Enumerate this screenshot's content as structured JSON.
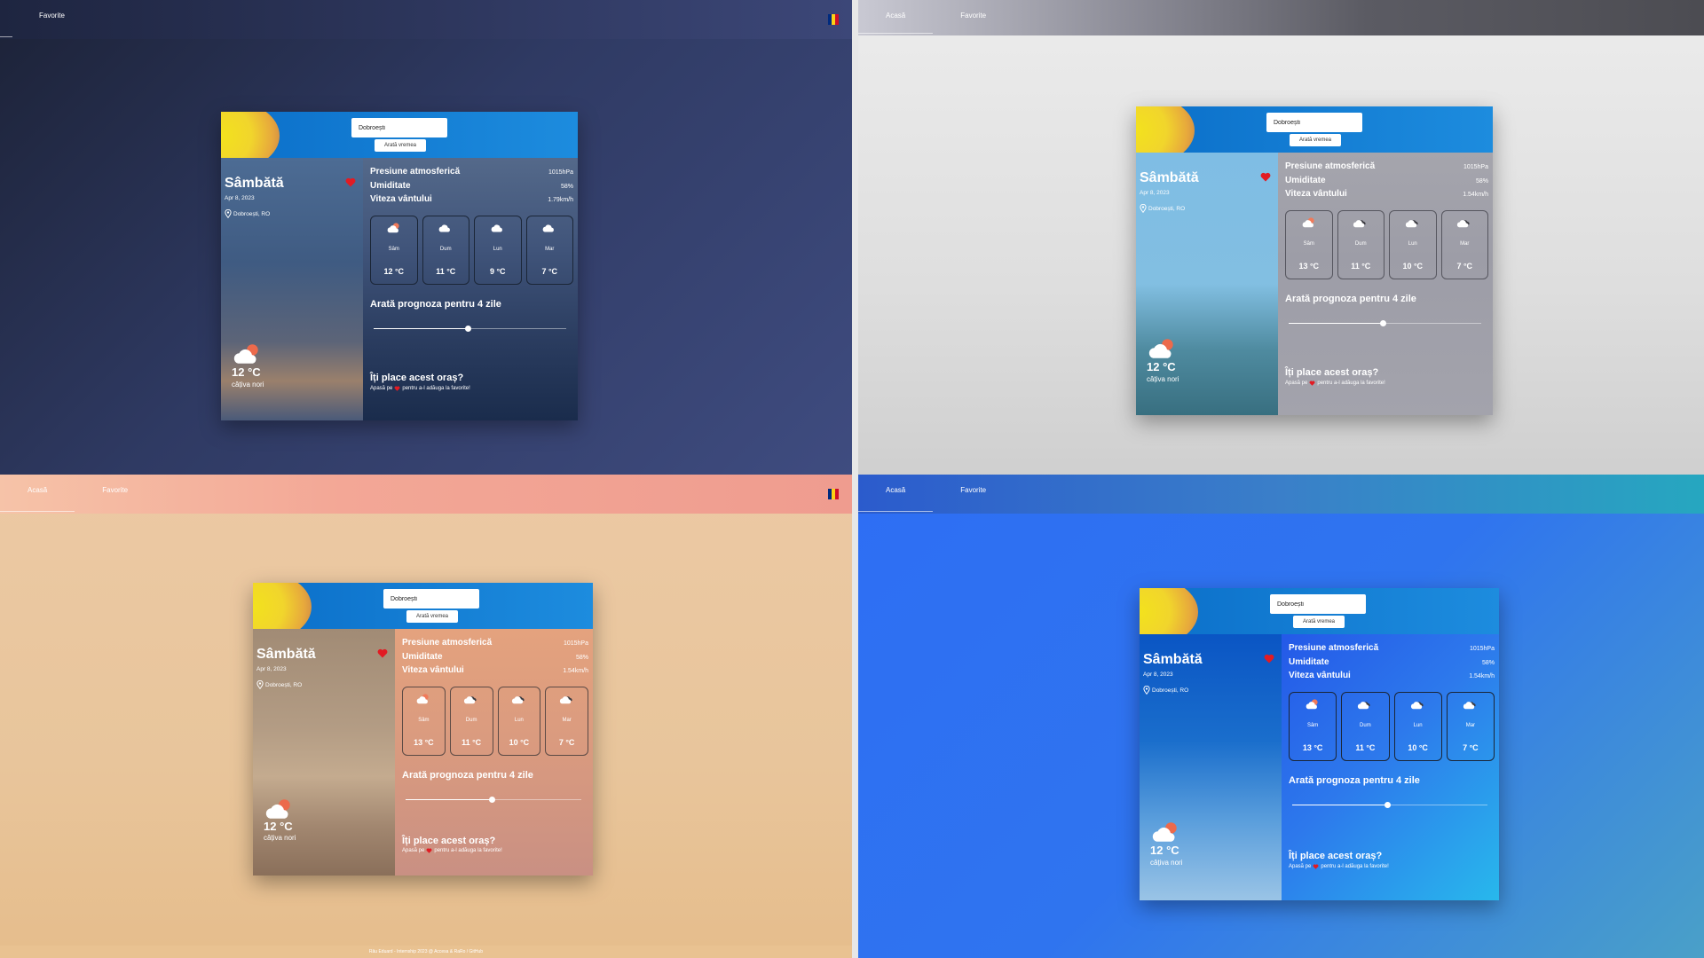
{
  "nav": {
    "home": "Acasă",
    "favorites": "Favorite"
  },
  "colors": {
    "accent_red": "#e21b23",
    "flag": [
      "#002b7f",
      "#fcd116",
      "#ce1126"
    ],
    "card_header": "#1d8cde"
  },
  "panels": [
    {
      "theme": "rain-night",
      "show_home": false,
      "show_flag": true,
      "search_value": "Dobroești",
      "show_button": "Arată vremea",
      "day": "Sâmbătă",
      "date": "Apr 8, 2023",
      "location": "Dobroești, RO",
      "current_temp": "12 °C",
      "current_desc": "câțiva nori",
      "stats": [
        {
          "label": "Presiune atmosferică",
          "value": "1015hPa"
        },
        {
          "label": "Umiditate",
          "value": "58%"
        },
        {
          "label": "Viteza vântului",
          "value": "1.79km/h"
        }
      ],
      "forecast": [
        {
          "day": "Sâm",
          "temp": "12 °C",
          "icon": "sun-cloud-icon"
        },
        {
          "day": "Dum",
          "temp": "11 °C",
          "icon": "cloud-icon"
        },
        {
          "day": "Lun",
          "temp": "9 °C",
          "icon": "cloud-icon"
        },
        {
          "day": "Mar",
          "temp": "7 °C",
          "icon": "cloud-icon"
        }
      ],
      "forecast_title": "Arată prognoza pentru 4 zile",
      "slider_fraction": 0.49,
      "like_title": "Îți place acest oraș?",
      "like_sub_before": "Apasă pe",
      "like_sub_after": "pentru a-l adăuga la favorite!"
    },
    {
      "theme": "foggy-forest",
      "show_home": true,
      "show_flag": false,
      "search_value": "Dobroești",
      "show_button": "Arată vremea",
      "day": "Sâmbătă",
      "date": "Apr 8, 2023",
      "location": "Dobroești, RO",
      "current_temp": "12 °C",
      "current_desc": "câțiva nori",
      "stats": [
        {
          "label": "Presiune atmosferică",
          "value": "1015hPa"
        },
        {
          "label": "Umiditate",
          "value": "58%"
        },
        {
          "label": "Viteza vântului",
          "value": "1.54km/h"
        }
      ],
      "forecast": [
        {
          "day": "Sâm",
          "temp": "13 °C",
          "icon": "sun-cloud-icon"
        },
        {
          "day": "Dum",
          "temp": "11 °C",
          "icon": "dark-cloud-icon"
        },
        {
          "day": "Lun",
          "temp": "10 °C",
          "icon": "dark-cloud-icon"
        },
        {
          "day": "Mar",
          "temp": "7 °C",
          "icon": "dark-cloud-icon"
        }
      ],
      "forecast_title": "Arată prognoza pentru 4 zile",
      "slider_fraction": 0.49,
      "like_title": "Îți place acest oraș?",
      "like_sub_before": "Apasă pe",
      "like_sub_after": "pentru a-l adăuga la favorite!"
    },
    {
      "theme": "desert-dust",
      "show_home": true,
      "show_flag": true,
      "search_value": "Dobroești",
      "show_button": "Arată vremea",
      "day": "Sâmbătă",
      "date": "Apr 8, 2023",
      "location": "Dobroești, RO",
      "current_temp": "12 °C",
      "current_desc": "câțiva nori",
      "stats": [
        {
          "label": "Presiune atmosferică",
          "value": "1015hPa"
        },
        {
          "label": "Umiditate",
          "value": "58%"
        },
        {
          "label": "Viteza vântului",
          "value": "1.54km/h"
        }
      ],
      "forecast": [
        {
          "day": "Sâm",
          "temp": "13 °C",
          "icon": "sun-cloud-icon"
        },
        {
          "day": "Dum",
          "temp": "11 °C",
          "icon": "dark-cloud-icon"
        },
        {
          "day": "Lun",
          "temp": "10 °C",
          "icon": "dark-cloud-icon"
        },
        {
          "day": "Mar",
          "temp": "7 °C",
          "icon": "dark-cloud-icon"
        }
      ],
      "forecast_title": "Arată prognoza pentru 4 zile",
      "slider_fraction": 0.49,
      "like_title": "Îți place acest oraș?",
      "like_sub_before": "Apasă pe",
      "like_sub_after": "pentru a-l adăuga la favorite!"
    },
    {
      "theme": "blue-sky",
      "show_home": true,
      "show_flag": false,
      "search_value": "Dobroești",
      "show_button": "Arată vremea",
      "day": "Sâmbătă",
      "date": "Apr 8, 2023",
      "location": "Dobroești, RO",
      "current_temp": "12 °C",
      "current_desc": "câțiva nori",
      "stats": [
        {
          "label": "Presiune atmosferică",
          "value": "1015hPa"
        },
        {
          "label": "Umiditate",
          "value": "58%"
        },
        {
          "label": "Viteza vântului",
          "value": "1.54km/h"
        }
      ],
      "forecast": [
        {
          "day": "Sâm",
          "temp": "13 °C",
          "icon": "sun-cloud-icon"
        },
        {
          "day": "Dum",
          "temp": "11 °C",
          "icon": "dark-cloud-icon"
        },
        {
          "day": "Lun",
          "temp": "10 °C",
          "icon": "dark-cloud-icon"
        },
        {
          "day": "Mar",
          "temp": "7 °C",
          "icon": "dark-cloud-icon"
        }
      ],
      "forecast_title": "Arată prognoza pentru 4 zile",
      "slider_fraction": 0.49,
      "like_title": "Îți place acest oraș?",
      "like_sub_before": "Apasă pe",
      "like_sub_after": "pentru a-l adăuga la favorite!"
    }
  ],
  "footer": "Rău Eduard - Internship 2023 @ Accesa & RaRo / GitHub"
}
